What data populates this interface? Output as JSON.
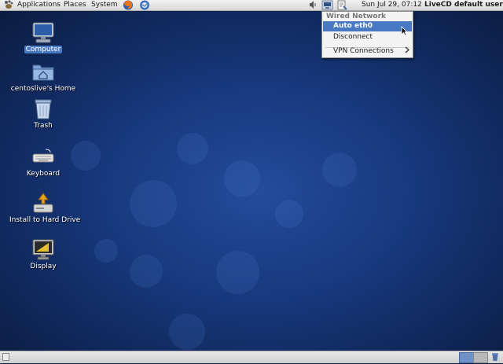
{
  "top_panel": {
    "applications_label": "Applications",
    "places_label": "Places",
    "system_label": "System",
    "clock": "Sun Jul 29, 07:12",
    "user": "LiveCD default user"
  },
  "desktop_icons": [
    {
      "label": "Computer",
      "icon": "computer-icon",
      "selected": true
    },
    {
      "label": "centoslive's Home",
      "icon": "home-folder-icon"
    },
    {
      "label": "Trash",
      "icon": "trash-icon"
    },
    {
      "label": "Keyboard",
      "icon": "keyboard-icon"
    },
    {
      "label": "Install to Hard Drive",
      "icon": "install-drive-icon"
    },
    {
      "label": "Display",
      "icon": "display-icon"
    }
  ],
  "network_menu": {
    "header": "Wired Network",
    "items": [
      {
        "label": "Auto eth0",
        "active": true
      },
      {
        "label": "Disconnect"
      },
      {
        "label": "VPN Connections",
        "submenu": true
      }
    ]
  },
  "colors": {
    "desktop_center": "#234c9a",
    "desktop_edge": "#091734",
    "selection": "#4a79c4",
    "panel": "#e0e0e0"
  }
}
